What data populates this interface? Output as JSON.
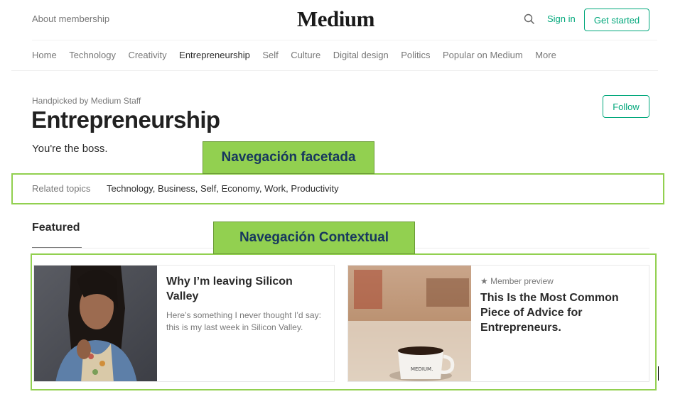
{
  "header": {
    "about": "About membership",
    "logo": "Medium",
    "sign_in": "Sign in",
    "get_started": "Get started",
    "search_icon": "search-icon"
  },
  "nav": {
    "items": [
      "Home",
      "Technology",
      "Creativity",
      "Entrepreneurship",
      "Self",
      "Culture",
      "Digital design",
      "Politics",
      "Popular on Medium",
      "More"
    ],
    "active": "Entrepreneurship"
  },
  "topic": {
    "handpicked": "Handpicked by Medium Staff",
    "title": "Entrepreneurship",
    "subtitle": "You're the boss.",
    "follow": "Follow"
  },
  "related": {
    "label": "Related topics",
    "list": "Technology, Business, Self, Economy, Work, Productivity"
  },
  "featured": {
    "label": "Featured"
  },
  "annotations": {
    "faceted": "Navegación facetada",
    "contextual": "Navegación Contextual",
    "highlight_color": "#92d050",
    "text_color": "#17375e"
  },
  "cards": [
    {
      "title": "Why I’m leaving Silicon Valley",
      "subtitle": "Here’s something I never thought I’d say: this is my last week in Silicon Valley."
    },
    {
      "badge": "★ Member preview",
      "title": "This Is the Most Common Piece of Advice for Entrepreneurs."
    }
  ],
  "colors": {
    "accent": "#03a87c"
  }
}
